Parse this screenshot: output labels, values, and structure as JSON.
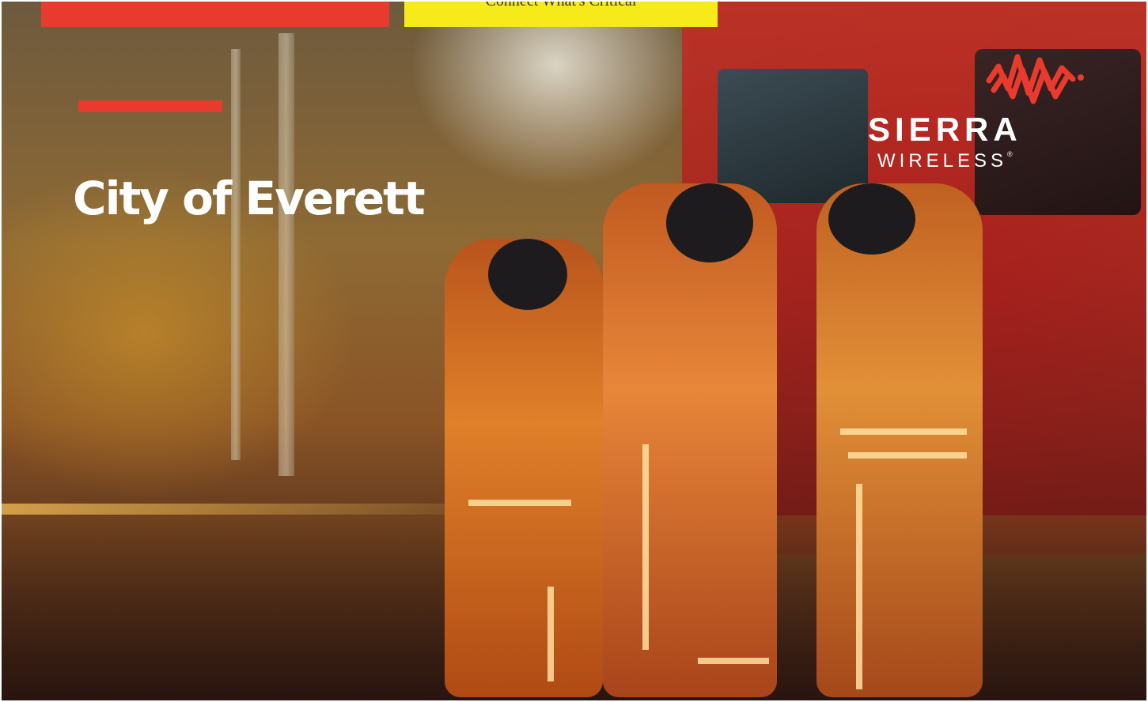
{
  "top_banner": {
    "tagline": "Connect What's Critical",
    "accent_red": "#e83b2e",
    "accent_yellow": "#f6ea1a"
  },
  "slide": {
    "title": "City of Everett",
    "background_icon": "firefighters-fire-truck-photo"
  },
  "logo": {
    "brand_line1": "SIERRA",
    "brand_line2": "WIRELESS",
    "registered_mark": "®",
    "icon": "wave-mark-icon",
    "mark_color": "#e83b2e"
  }
}
